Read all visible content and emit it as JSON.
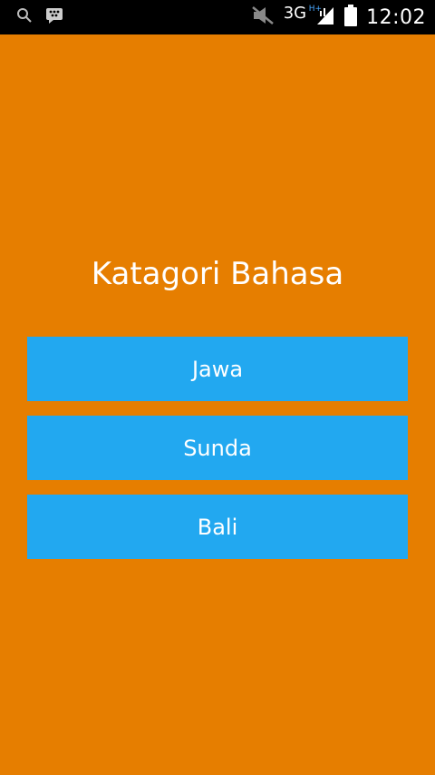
{
  "status_bar": {
    "network": "3G",
    "network_sub": "H+",
    "time": "12:02",
    "icons": [
      "search-icon",
      "bbm-icon",
      "mute-icon",
      "signal-icon",
      "battery-icon"
    ]
  },
  "title": "Katagori Bahasa",
  "categories": [
    "Jawa",
    "Sunda",
    "Bali"
  ],
  "colors": {
    "background": "#E67E00",
    "button": "#22A8F0",
    "text": "#FFFFFF",
    "status_bar": "#000000"
  }
}
